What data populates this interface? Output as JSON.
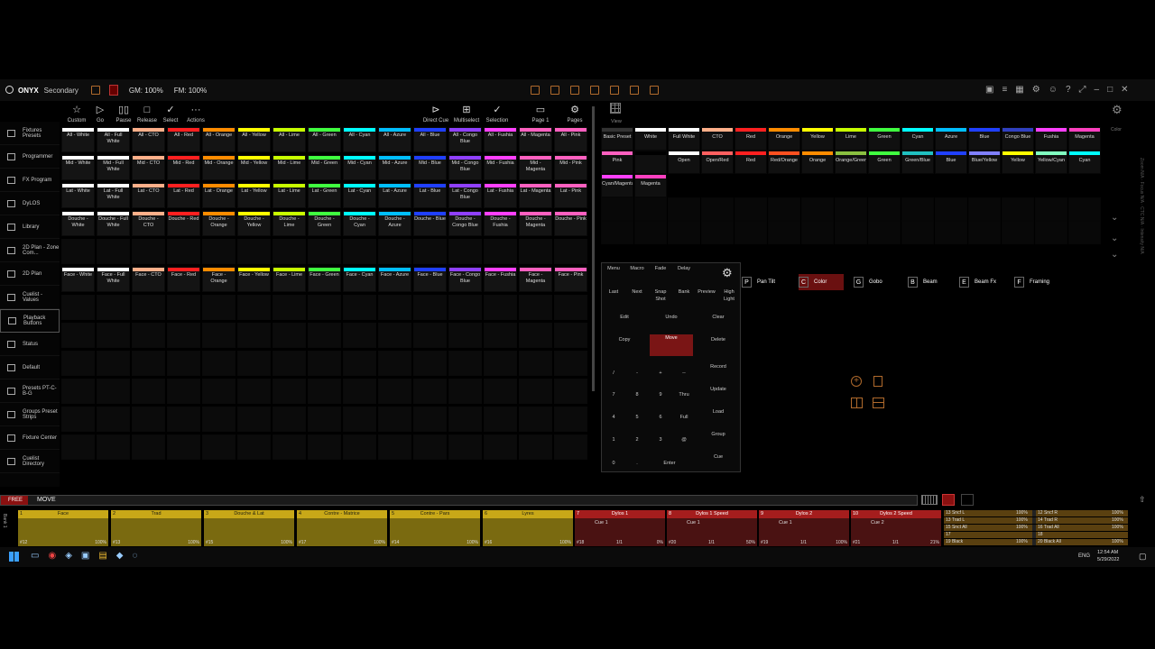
{
  "app": {
    "brand": "ONYX",
    "mode": "Secondary",
    "gm": "GM: 100%",
    "fm": "FM: 100%"
  },
  "sidebar": [
    {
      "label": "Fixtures Presets"
    },
    {
      "label": "Programmer"
    },
    {
      "label": "FX Program"
    },
    {
      "label": "DyLOS"
    },
    {
      "label": "Library"
    },
    {
      "label": "2D Plan - Zone Com..."
    },
    {
      "label": "2D Plan"
    },
    {
      "label": "Cuelist - Values"
    },
    {
      "label": "Playback Buttons"
    },
    {
      "label": "Status"
    },
    {
      "label": "Default"
    },
    {
      "label": "Presets PT-C-B-G"
    },
    {
      "label": "Groups Preset Strips"
    },
    {
      "label": "Fixture Center"
    },
    {
      "label": "Cuelist Directory"
    }
  ],
  "toolbar": [
    {
      "icon": "☆",
      "label": "Custom"
    },
    {
      "icon": "▷",
      "label": "Go"
    },
    {
      "icon": "▯▯",
      "label": "Pause"
    },
    {
      "icon": "□",
      "label": "Release"
    },
    {
      "icon": "✓",
      "label": "Select"
    },
    {
      "icon": "···",
      "label": "Actions"
    },
    {
      "icon": "⊳",
      "label": "Direct Cue"
    },
    {
      "icon": "⊞",
      "label": "Multiselect"
    },
    {
      "icon": "✓",
      "label": "Selection"
    },
    {
      "icon": "▭",
      "label": "Page 1"
    },
    {
      "icon": "⚙",
      "label": "Pages"
    }
  ],
  "colors": [
    "#ffffff",
    "#ffffff",
    "#ffb08a",
    "#ff2020",
    "#ff8c00",
    "#ffff00",
    "#c8ff00",
    "#40ff40",
    "#00ffff",
    "#00bfff",
    "#2040ff",
    "#9040ff",
    "#ff40ff",
    "#ff60c0"
  ],
  "grid_rows": [
    [
      "All - White",
      "All - Full White",
      "All - CTO",
      "All - Red",
      "All - Orange",
      "All - Yellow",
      "All - Lime",
      "All - Green",
      "All - Cyan",
      "All - Azure",
      "All - Blue",
      "All - Congo Blue",
      "All - Fushia",
      "All - Magenta",
      "All - Pink"
    ],
    [
      "Mid - White",
      "Mid - Full White",
      "Mid - CTO",
      "Mid - Red",
      "Mid - Orange",
      "Mid - Yellow",
      "Mid - Lime",
      "Mid - Green",
      "Mid - Cyan",
      "Mid - Azure",
      "Mid - Blue",
      "Mid - Congo Blue",
      "Mid - Fushia",
      "Mid - Magenta",
      "Mid - Pink"
    ],
    [
      "Lat - White",
      "Lat - Full White",
      "Lat - CTO",
      "Lat - Red",
      "Lat - Orange",
      "Lat - Yellow",
      "Lat - Lime",
      "Lat - Green",
      "Lat - Cyan",
      "Lat - Azure",
      "Lat - Blue",
      "Lat - Congo Blue",
      "Lat - Fushia",
      "Lat - Magenta",
      "Lat - Pink"
    ],
    [
      "Douche - White",
      "Douche - Full White",
      "Douche - CTO",
      "Douche - Red",
      "Douche - Orange",
      "Douche - Yellow",
      "Douche - Lime",
      "Douche - Green",
      "Douche - Cyan",
      "Douche - Azure",
      "Douche - Blue",
      "Douche - Congo Blue",
      "Douche - Fushia",
      "Douche - Magenta",
      "Douche - Pink"
    ],
    [
      "Face - White",
      "Face - Full White",
      "Face - CTO",
      "Face - Red",
      "Face - Orange",
      "Face - Yellow",
      "Face - Lime",
      "Face - Green",
      "Face - Cyan",
      "Face - Azure",
      "Face - Blue",
      "Face - Congo Blue",
      "Face - Fushia",
      "Face - Magenta",
      "Face - Pink"
    ]
  ],
  "presets_row1": [
    "Basic Preset",
    "White",
    "Full White",
    "CTO",
    "Red",
    "Orange",
    "Yellow",
    "Lime",
    "Green",
    "Cyan",
    "Azure",
    "Blue",
    "Congo Blue",
    "Fushia",
    "Magenta"
  ],
  "presets_row2": [
    "Pink",
    "",
    "Open",
    "Open/Red",
    "Red",
    "Red/Orange",
    "Orange",
    "Orange/Green",
    "Green",
    "Green/Blue",
    "Blue",
    "Blue/Yellow",
    "Yellow",
    "Yellow/Cyan",
    "Cyan"
  ],
  "presets_row3": [
    "Cyan/Magenta",
    "Magenta"
  ],
  "keypad": [
    [
      "Menu",
      "Macro",
      "Fade",
      "Delay"
    ],
    [
      "Last",
      "Next",
      "Snap Shot",
      "Bank",
      "Preview",
      "High Light"
    ],
    [
      "Edit",
      "Undo",
      "Clear"
    ],
    [
      "Copy",
      "Move",
      "Delete"
    ],
    [
      "/",
      "-",
      "+",
      "--",
      "Record"
    ],
    [
      "7",
      "8",
      "9",
      "Thru",
      "Update"
    ],
    [
      "4",
      "5",
      "6",
      "Full",
      "Load"
    ],
    [
      "1",
      "2",
      "3",
      "@",
      "Group"
    ],
    [
      "0",
      ".",
      "Enter",
      "Cue"
    ]
  ],
  "families": [
    {
      "key": "P",
      "label": "Pan Tilt"
    },
    {
      "key": "C",
      "label": "Color"
    },
    {
      "key": "G",
      "label": "Gobo"
    },
    {
      "key": "B",
      "label": "Beam"
    },
    {
      "key": "E",
      "label": "Beam Fx"
    },
    {
      "key": "F",
      "label": "Framing"
    }
  ],
  "command": {
    "status": "FREE",
    "text": "MOVE"
  },
  "playbacks": [
    {
      "num": "1",
      "name": "Face",
      "id": "#12",
      "pct": "100%"
    },
    {
      "num": "2",
      "name": "Trad",
      "id": "#13",
      "pct": "100%"
    },
    {
      "num": "3",
      "name": "Douche & Lat",
      "id": "#15",
      "pct": "100%"
    },
    {
      "num": "4",
      "name": "Contre - Matrice",
      "id": "#17",
      "pct": "100%"
    },
    {
      "num": "5",
      "name": "Contre - Pars",
      "id": "#14",
      "pct": "100%"
    },
    {
      "num": "6",
      "name": "Lyres",
      "id": "#16",
      "pct": "100%"
    },
    {
      "num": "7",
      "name": "Dylos 1",
      "id": "#18",
      "cue": "Cue 1",
      "step": "1/1",
      "pct": "0%"
    },
    {
      "num": "8",
      "name": "Dylos 1 Speed",
      "id": "#20",
      "cue": "Cue 1",
      "step": "1/1",
      "pct": "50%"
    },
    {
      "num": "9",
      "name": "Dylos 2",
      "id": "#19",
      "cue": "Cue 1",
      "step": "1/1",
      "pct": "100%"
    },
    {
      "num": "10",
      "name": "Dylos 2 Speed",
      "id": "#21",
      "cue": "Cue 2",
      "step": "1/1",
      "pct": "21%"
    }
  ],
  "mini_list": [
    [
      "13 Sncf L",
      "100%",
      "12 Sncf R",
      "100%"
    ],
    [
      "13 Trad L",
      "100%",
      "14 Trad R",
      "100%"
    ],
    [
      "15 Snct All",
      "100%",
      "16 Trad All",
      "100%"
    ],
    [
      "17",
      "",
      "18",
      ""
    ],
    [
      "19 Black",
      "100%",
      "20 Black All",
      "100%"
    ]
  ],
  "clock": {
    "time": "12:54 AM",
    "date": "5/29/2022"
  },
  "tray": {
    "lang": "ENG"
  }
}
